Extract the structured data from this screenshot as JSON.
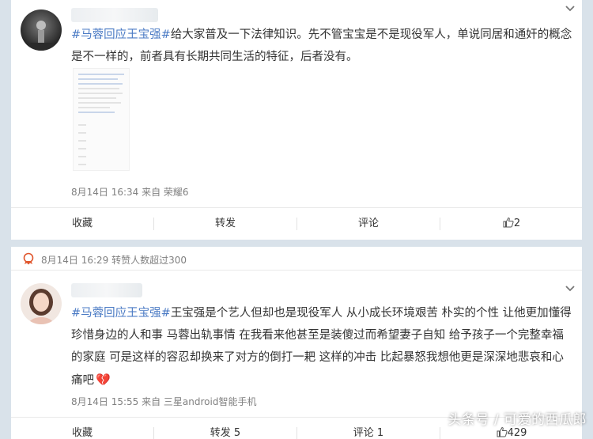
{
  "post1": {
    "hashtag": "#马蓉回应王宝强#",
    "text_line1": "给大家普及一下法律知识。先不管宝宝是不是现役军人，单说同居和通奸的概念",
    "text_line2": "是不一样的，前者具有长期共同生活的特征，后者没有。",
    "meta": "8月14日 16:34 来自 荣耀6",
    "actions": {
      "collect": "收藏",
      "repost": "转发",
      "comment": "评论",
      "like_count": "2"
    }
  },
  "post2": {
    "header_meta": "8月14日 16:29  转赞人数超过300",
    "hashtag": "#马蓉回应王宝强#",
    "text_line1": "王宝强是个艺人但却也是现役军人 从小成长环境艰苦 朴实的个性 让他更加懂得",
    "text_line2": "珍惜身边的人和事 马蓉出轨事情 在我看来他甚至是装傻过而希望妻子自知 给予孩子一个完整幸福",
    "text_line3": "的家庭 可是这样的容忍却换来了对方的倒打一耙 这样的冲击 比起暴怒我想他更是深深地悲哀和心",
    "text_line4": "痛吧",
    "emoji": "💔",
    "meta": "8月14日 15:55 来自 三星android智能手机",
    "actions": {
      "collect": "收藏",
      "repost": "转发 5",
      "comment": "评论 1",
      "like_count": "429"
    }
  },
  "watermark": "头条号 / 可爱的西瓜郎",
  "colors": {
    "hashtag": "#4a7ac4",
    "background": "#d9e2ea",
    "badge": "#e0562d"
  }
}
